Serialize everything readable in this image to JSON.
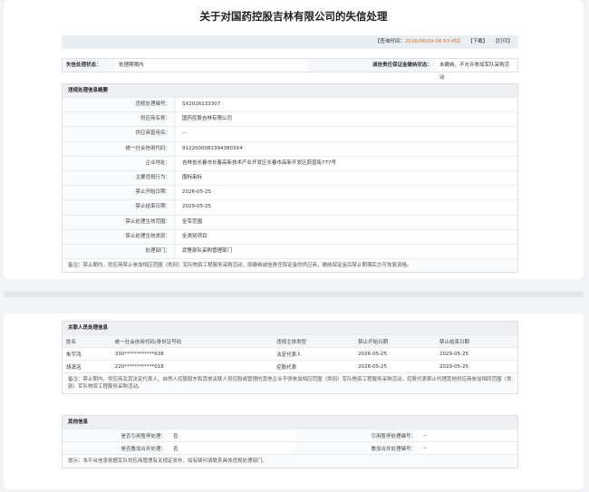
{
  "title": "关于对国药控股吉林有限公司的失信处理",
  "toolbar": {
    "query_label": "【查询时间：",
    "query_time": "2026/06/09 08:53:45】",
    "download": "【下载】",
    "print": "【打印】"
  },
  "status": {
    "label1": "失信处理状态：",
    "value1": "处理期限内",
    "label2": "诚信责任保证金缴纳状态：",
    "value2": "未缴纳，不允许参加军队采购活动"
  },
  "violation": {
    "heading": "违规处理信息概要",
    "rows": [
      {
        "k": "违规处理编号：",
        "v": "SX2026133307"
      },
      {
        "k": "供应商名称：",
        "v": "国药控股吉林有限公司"
      },
      {
        "k": "供应商曾用名：",
        "v": "--"
      },
      {
        "k": "统一社会信用代码：",
        "v": "91220000823943803X4"
      },
      {
        "k": "企业地址：",
        "v": "吉林省长春市长春高新技术产业开发区长春市高新开发区蔚蓝街777号"
      },
      {
        "k": "主要违规行为：",
        "v": "围标串标"
      },
      {
        "k": "禁止开始日期：",
        "v": "2026-05-25"
      },
      {
        "k": "禁止结束日期：",
        "v": "2029-05-25"
      },
      {
        "k": "禁止处理生效范围：",
        "v": "全军范围"
      },
      {
        "k": "禁止处理生效类别：",
        "v": "全类别项目"
      },
      {
        "k": "处理部门：",
        "v": "武警部队采购管理部门"
      }
    ],
    "note": "备注：禁止期内，供应商禁止参加相应范围（类别）军队物资工程服务采购活动，原缴纳诚信责任保证金的供应商，缴纳保证金后禁止期满后方可恢复资格。"
  },
  "persons": {
    "heading": "关联人员处理信息",
    "columns": [
      "姓名",
      "统一社会信用代码/身份证号码",
      "违规主体类型",
      "禁止开始日期",
      "禁止结束日期"
    ],
    "rows": [
      [
        "朱宇鸿",
        "330************638",
        "法定代表人",
        "2026-05-25",
        "2029-05-25"
      ],
      [
        "胡潇洺",
        "220************018",
        "控股代表",
        "2026-05-25",
        "2029-05-25"
      ]
    ],
    "note": "备注：禁止期内，供应商及其法定代表人、自然人控股股东和其他关联人员控股或管理的其他企业不得参加相应范围（类别）军队物资工程服务采购活动，控股代表禁止代理其他供应商参加相同范围（类别）军队物资工程服务采购活动。"
  },
  "other": {
    "heading": "其他信息",
    "r1": {
      "l1": "是否引用暂停处理：",
      "v1": "否",
      "l2": "引用暂停处理编号：",
      "v2": "--"
    },
    "r2": {
      "l1": "是否叠加合并处理：",
      "v1": "否",
      "l2": "叠加合并处理编号：",
      "v2": "--"
    },
    "note": "提示：本平台信息依据军队供应商管理有关规定发布，如有疑问请联系具体违规处理部门。"
  }
}
